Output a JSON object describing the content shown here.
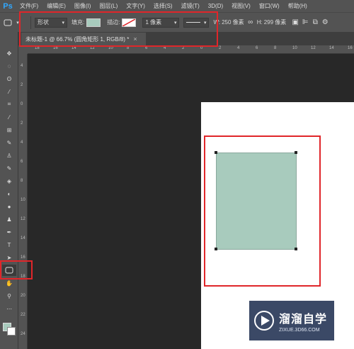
{
  "app": {
    "logo": "Ps"
  },
  "menu": [
    "文件(F)",
    "编辑(E)",
    "图像(I)",
    "图层(L)",
    "文字(Y)",
    "选择(S)",
    "滤镜(T)",
    "3D(D)",
    "视图(V)",
    "窗口(W)",
    "帮助(H)"
  ],
  "options": {
    "mode": "形状",
    "fill_label": "填充:",
    "fill_color": "#a8cbbd",
    "stroke_label": "描边:",
    "stroke_width": "1 像素",
    "width_label": "W:",
    "width_value": "250 像素",
    "height_label": "H:",
    "height_value": "299 像素"
  },
  "document": {
    "tab_title": "未标题-1 @ 66.7% (圆角矩形 1, RGB/8) *",
    "close": "×"
  },
  "ruler": {
    "top_labels": [
      "18",
      "16",
      "14",
      "12",
      "10",
      "8",
      "6",
      "4",
      "2",
      "0",
      "2",
      "4",
      "6",
      "8",
      "10",
      "12",
      "14",
      "16"
    ],
    "left_labels": [
      "4",
      "2",
      "0",
      "2",
      "4",
      "6",
      "8",
      "10",
      "12",
      "14",
      "16",
      "18",
      "20",
      "22",
      "24"
    ]
  },
  "shape": {
    "color": "#a8cbbd"
  },
  "watermark": {
    "title": "溜溜自学",
    "url": "ZIXUE.3D66.COM"
  }
}
